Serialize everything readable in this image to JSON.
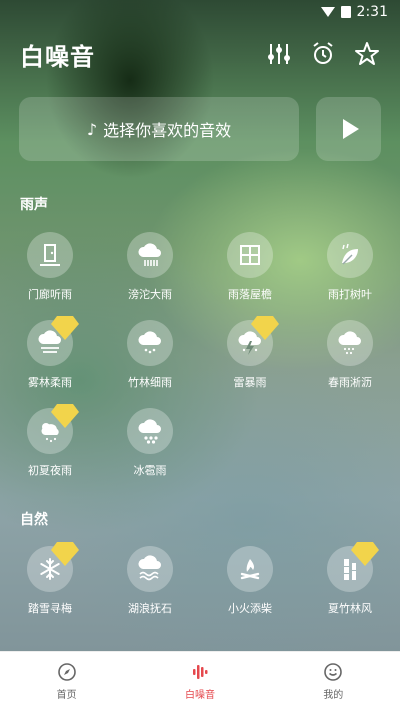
{
  "status_bar": {
    "time": "2:31"
  },
  "header": {
    "title": "白噪音"
  },
  "picker": {
    "note": "♪",
    "label": "选择你喜欢的音效"
  },
  "sections": {
    "rain": {
      "title": "雨声"
    },
    "nature": {
      "title": "自然"
    }
  },
  "rain_items": [
    {
      "label": "门廊听雨",
      "icon": "door-icon",
      "premium": false
    },
    {
      "label": "滂沱大雨",
      "icon": "heavy-rain-cloud-icon",
      "premium": false
    },
    {
      "label": "雨落屋檐",
      "icon": "window-icon",
      "premium": false
    },
    {
      "label": "雨打树叶",
      "icon": "leaf-rain-icon",
      "premium": false
    },
    {
      "label": "雾林柔雨",
      "icon": "fog-cloud-icon",
      "premium": true
    },
    {
      "label": "竹林细雨",
      "icon": "light-rain-cloud-icon",
      "premium": false
    },
    {
      "label": "雷暴雨",
      "icon": "thunderstorm-icon",
      "premium": true
    },
    {
      "label": "春雨淅沥",
      "icon": "drizzle-cloud-icon",
      "premium": false
    },
    {
      "label": "初夏夜雨",
      "icon": "night-rain-icon",
      "premium": true
    },
    {
      "label": "冰雹雨",
      "icon": "hail-cloud-icon",
      "premium": false
    }
  ],
  "nature_items": [
    {
      "label": "踏雪寻梅",
      "icon": "snowflake-icon",
      "premium": true
    },
    {
      "label": "湖浪抚石",
      "icon": "lake-wave-icon",
      "premium": false
    },
    {
      "label": "小火添柴",
      "icon": "campfire-icon",
      "premium": false
    },
    {
      "label": "夏竹林风",
      "icon": "bamboo-icon",
      "premium": true
    }
  ],
  "tabs": [
    {
      "label": "首页",
      "icon": "compass-icon",
      "active": false
    },
    {
      "label": "白噪音",
      "icon": "sound-bars-icon",
      "active": true
    },
    {
      "label": "我的",
      "icon": "smile-icon",
      "active": false
    }
  ],
  "colors": {
    "active_tab": "#e5484d",
    "gem": "#f2d44b"
  }
}
